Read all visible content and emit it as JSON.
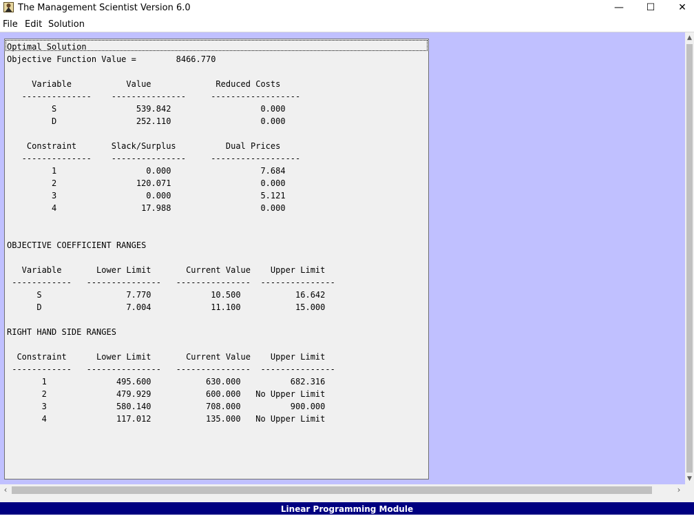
{
  "window": {
    "title": "The Management Scientist Version 6.0",
    "icon": "management-scientist-app-icon",
    "controls": {
      "minimize": "—",
      "maximize": "☐",
      "close": "✕"
    }
  },
  "menu": {
    "file": "File",
    "edit": "Edit",
    "solution": "Solution"
  },
  "output": {
    "lines": [
      "Optimal Solution",
      "Objective Function Value =        8466.770",
      "",
      "     Variable           Value             Reduced Costs",
      "   --------------    ---------------     ------------------",
      "         S                539.842                  0.000",
      "         D                252.110                  0.000",
      "",
      "    Constraint       Slack/Surplus          Dual Prices",
      "   --------------    ---------------     ------------------",
      "         1                  0.000                  7.684",
      "         2                120.071                  0.000",
      "         3                  0.000                  5.121",
      "         4                 17.988                  0.000",
      "",
      "",
      "OBJECTIVE COEFFICIENT RANGES",
      "",
      "   Variable       Lower Limit       Current Value    Upper Limit",
      " ------------   ---------------   ---------------  ---------------",
      "      S                 7.770            10.500           16.642",
      "      D                 7.004            11.100           15.000",
      "",
      "RIGHT HAND SIDE RANGES",
      "",
      "  Constraint      Lower Limit       Current Value    Upper Limit",
      " ------------   ---------------   ---------------  ---------------",
      "       1              495.600           630.000          682.316",
      "       2              479.929           600.000   No Upper Limit",
      "       3              580.140           708.000          900.000",
      "       4              117.012           135.000   No Upper Limit"
    ]
  },
  "scrollbars": {
    "up": "▲",
    "down": "▼",
    "left": "‹",
    "right": "›"
  },
  "status": {
    "text": "Linear Programming Module"
  },
  "colors": {
    "client_background": "#c0c0ff",
    "output_background": "#f0f0f0",
    "status_background": "#000080",
    "status_text": "#ffffff"
  }
}
